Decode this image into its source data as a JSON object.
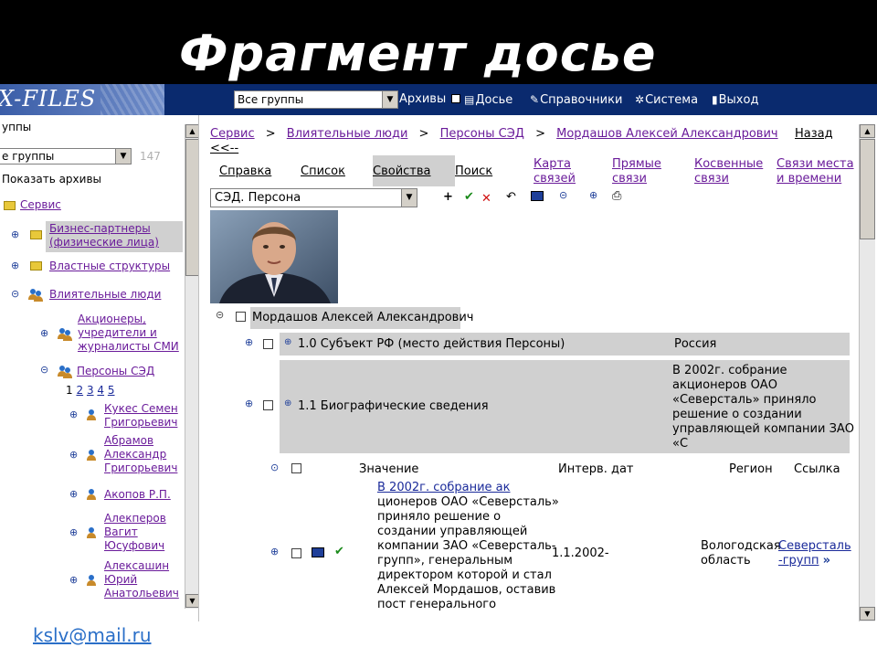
{
  "slide": {
    "title": "Фрагмент досье",
    "footer_email": "kslv@mail.ru"
  },
  "appbar": {
    "logo_text": "X-FILES",
    "group_select_value": "Все группы",
    "menu": [
      {
        "label": "Архивы",
        "icon": "checkbox-icon"
      },
      {
        "label": "Досье",
        "icon": "document-icon"
      },
      {
        "label": "Справочники",
        "icon": "handbook-icon"
      },
      {
        "label": "Система",
        "icon": "gear-icon"
      },
      {
        "label": "Выход",
        "icon": "exit-icon"
      }
    ]
  },
  "left_panel": {
    "header_label": "уппы",
    "group_select_value": "е группы",
    "group_count": "147",
    "show_archives_label": "Показать архивы",
    "tree": [
      {
        "label": "Сервис",
        "icon": "folder-icon"
      },
      {
        "label": "Бизнес-партнеры (физические лица)",
        "line1": "Бизнес-партнеры",
        "line2": "(физические лица)",
        "icon": "folder-icon"
      },
      {
        "label": "Властные структуры",
        "icon": "folder-icon"
      },
      {
        "label": "Влиятельные люди",
        "icon": "people-icon"
      },
      {
        "line1": "Акционеры,",
        "line2": "учредители и",
        "line3": "журналисты СМИ",
        "icon": "people-icon"
      },
      {
        "label": "Персоны СЭД",
        "icon": "people-icon"
      }
    ],
    "pager": {
      "current": "1",
      "pages": [
        "2",
        "3",
        "4",
        "5"
      ]
    },
    "persons": [
      {
        "line1": "Кукес Семен",
        "line2": "Григорьевич"
      },
      {
        "line1": "Абрамов",
        "line2": "Александр",
        "line3": "Григорьевич"
      },
      {
        "line1": "Акопов Р.П."
      },
      {
        "line1": "Алекперов",
        "line2": "Вагит",
        "line3": "Юсуфович"
      },
      {
        "line1": "Алексашин",
        "line2": "Юрий",
        "line3": "Анатольевич"
      }
    ]
  },
  "breadcrumb": {
    "items": [
      "Сервис",
      "Влиятельные люди",
      "Персоны СЭД",
      "Мордашов Алексей Александрович"
    ],
    "separator": ">",
    "back_label": "Назад",
    "back_line2": "<<--"
  },
  "tabs": [
    {
      "label": "Справка"
    },
    {
      "label": "Список"
    },
    {
      "label": "Свойства",
      "active": true
    },
    {
      "label": "Поиск"
    },
    {
      "line1": "Карта",
      "line2": "связей"
    },
    {
      "line1": "Прямые",
      "line2": "связи"
    },
    {
      "line1": "Косвенные",
      "line2": "связи"
    },
    {
      "line1": "Связи места",
      "line2": "и времени"
    }
  ],
  "type_select_value": "СЭД. Персона",
  "toolbar_icons": [
    "add-icon",
    "confirm-check-icon",
    "delete-x-icon",
    "undo-icon",
    "photo-card-icon",
    "collapse-icon",
    "expand-icon",
    "print-icon"
  ],
  "person_name": "Мордашов Алексей Александрович",
  "attributes": [
    {
      "label": "1.0 Субъект РФ (место действия Персоны)",
      "value": "Россия"
    },
    {
      "label": "1.1 Биографические сведения",
      "value_lines": [
        "В 2002г. собрание",
        "акционеров ОАО",
        "«Северсталь» приняло",
        "решение о создании",
        "управляющей компании ЗАО",
        "«С"
      ]
    }
  ],
  "detail_table": {
    "headers": [
      "Значение",
      "Интерв. дат",
      "Регион",
      "Ссылка"
    ],
    "row": {
      "value_link": "В 2002г. собрание ак",
      "value_lines": [
        "ционеров ОАО «Северсталь»",
        "приняло решение о",
        "создании управляющей",
        "компании ЗАО «Северсталь-",
        "групп», генеральным",
        "директором которой и стал",
        "Алексей Мордашов, оставив",
        "пост генерального"
      ],
      "date": "1.1.2002-",
      "region_lines": [
        "Вологодская",
        "область"
      ],
      "link_lines": [
        "Северсталь",
        "-групп"
      ],
      "link_more": "»"
    }
  },
  "colors": {
    "title_band": "#000000",
    "appbar": "#0a2a6e",
    "row_gray": "#d0d0d0",
    "link_purple": "#6a1b9a",
    "footer_link": "#2a6fc8"
  }
}
